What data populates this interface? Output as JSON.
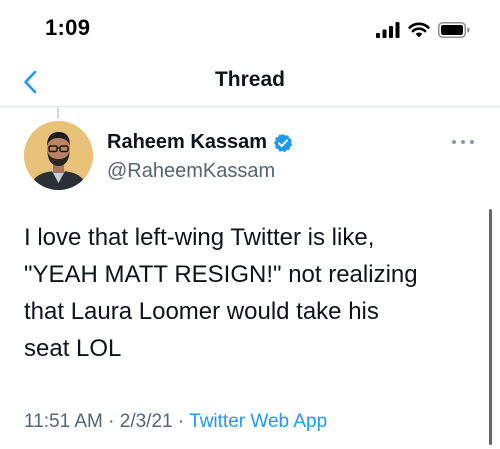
{
  "status_bar": {
    "time": "1:09",
    "icons": [
      "cellular-signal-icon",
      "wifi-icon",
      "battery-icon"
    ]
  },
  "nav": {
    "title": "Thread",
    "back_icon": "chevron-left-icon"
  },
  "tweet": {
    "author_name": "Raheem Kassam",
    "author_handle": "@RaheemKassam",
    "verified": true,
    "text": "I love that left-wing Twitter is like,\n\"YEAH MATT RESIGN!\" not realizing\nthat Laura Loomer would take his\nseat LOL",
    "time": "11:51 AM",
    "date": "2/3/21",
    "separator": "·",
    "source": "Twitter Web App"
  },
  "colors": {
    "accent": "#1d9bf0",
    "secondary_text": "#536471",
    "primary_text": "#0f1419",
    "divider": "#e1e6ea",
    "avatar_background": "#e8c37a"
  }
}
